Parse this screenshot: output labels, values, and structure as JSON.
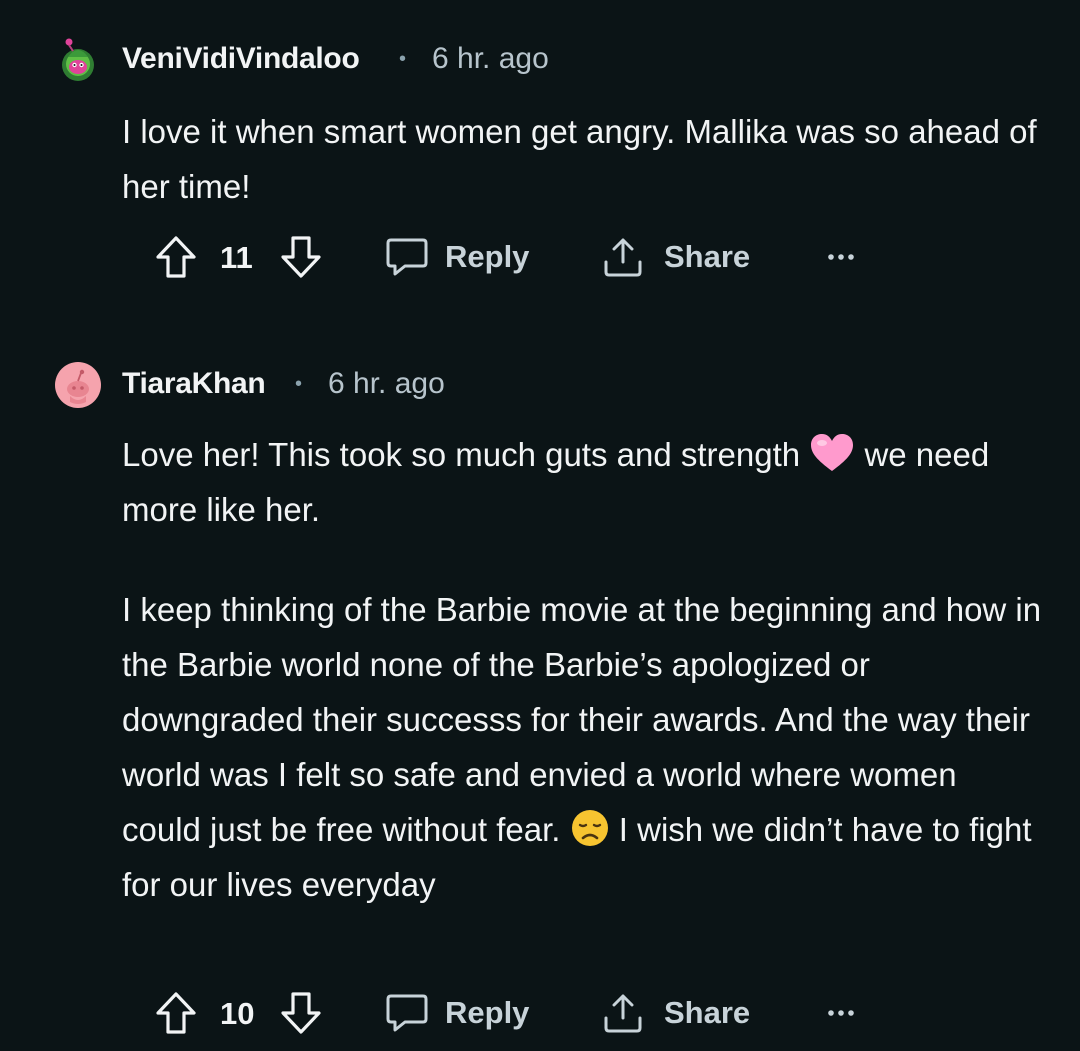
{
  "comments": [
    {
      "username": "VeniVidiVindaloo",
      "separator": "•",
      "time": "6 hr. ago",
      "paragraphs": [
        "I love it when smart women get angry. Mallika was so ahead of her time!"
      ],
      "score": "11",
      "reply_label": "Reply",
      "share_label": "Share",
      "avatar_icon": "green-snoo-avatar-icon"
    },
    {
      "username": "TiaraKhan",
      "separator": "•",
      "time": "6 hr. ago",
      "para1_before_emoji": "Love her! This took so much guts and strength ",
      "para1_after_emoji": " we need more like her.",
      "para2_before_emoji": "I keep thinking of the Barbie movie at the beginning and how in the Barbie world none of the Barbie’s apologized or downgraded their successs for their awards. And the way their world was I felt so safe and envied a world where women could just be free without fear. ",
      "para2_after_emoji": " I wish we didn’t have to fight for our lives everyday",
      "score": "10",
      "reply_label": "Reply",
      "share_label": "Share",
      "avatar_icon": "pink-snoo-avatar-icon"
    }
  ],
  "colors": {
    "background": "#0b1416",
    "text": "#f2f4f5",
    "meta": "#b7c4cc",
    "heart": "#ff8fc8",
    "sad_face": "#f7c430"
  }
}
